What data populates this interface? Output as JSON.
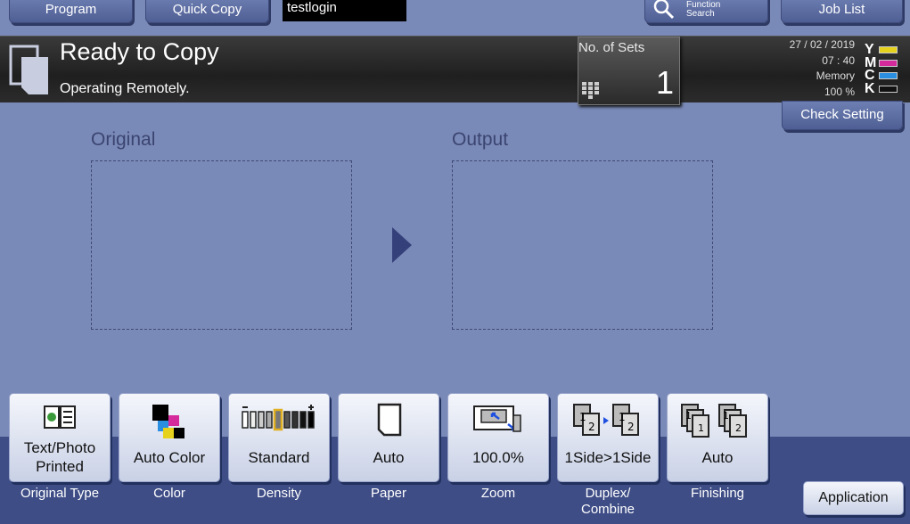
{
  "top": {
    "program": "Program",
    "quick_copy": "Quick Copy",
    "login_user": "testlogin",
    "function_search_line1": "Function",
    "function_search_line2": "Search",
    "job_list": "Job List"
  },
  "status": {
    "title": "Ready to Copy",
    "subtitle": "Operating Remotely.",
    "sets_label": "No. of Sets",
    "sets_value": "1",
    "date": "27 / 02 / 2019",
    "time": "07 : 40",
    "memory_label": "Memory",
    "memory_value": "100 %",
    "toner": [
      {
        "letter": "Y",
        "color": "#e6d21c"
      },
      {
        "letter": "M",
        "color": "#d42a9c"
      },
      {
        "letter": "C",
        "color": "#2a8fe0"
      },
      {
        "letter": "K",
        "color": "#111111"
      }
    ]
  },
  "check_setting": "Check Setting",
  "panels": {
    "original_title": "Original",
    "output_title": "Output"
  },
  "functions": [
    {
      "value_line1": "Text/Photo",
      "value_line2": "Printed",
      "label": "Original Type",
      "icon": "book-icon"
    },
    {
      "value_line1": "Auto Color",
      "label": "Color",
      "icon": "color-squares-icon"
    },
    {
      "value_line1": "Standard",
      "label": "Density",
      "icon": "density-bars-icon"
    },
    {
      "value_line1": "Auto",
      "label": "Paper",
      "icon": "paper-icon"
    },
    {
      "value_line1": "100.0%",
      "label": "Zoom",
      "icon": "zoom-icon"
    },
    {
      "value_line1": "1Side>1Side",
      "label_line1": "Duplex/",
      "label_line2": "Combine",
      "icon": "duplex-icon"
    },
    {
      "value_line1": "Auto",
      "label": "Finishing",
      "icon": "finishing-icon"
    }
  ],
  "application": "Application"
}
